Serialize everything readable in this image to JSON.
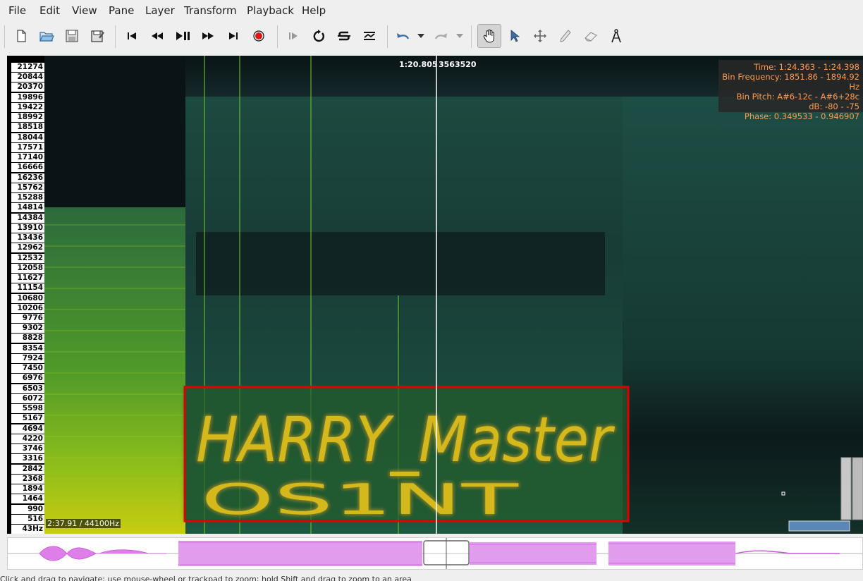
{
  "menubar": {
    "items": [
      {
        "label": "File"
      },
      {
        "label": "Edit"
      },
      {
        "label": "View"
      },
      {
        "label": "Pane"
      },
      {
        "label": "Layer"
      },
      {
        "label": "Transform"
      },
      {
        "label": "Playback"
      },
      {
        "label": "Help"
      }
    ]
  },
  "toolbar": {
    "icons": [
      "new-file-icon",
      "open-folder-icon",
      "save-icon",
      "save-as-icon",
      "rewind-start-icon",
      "rewind-icon",
      "play-pause-icon",
      "fast-forward-icon",
      "fast-forward-end-icon",
      "record-icon",
      "play-selection-icon",
      "loop-icon",
      "solo-icon",
      "normalize-icon",
      "undo-icon",
      "undo-dropdown-icon",
      "redo-icon",
      "redo-dropdown-icon",
      "navigate-hand-icon",
      "select-pointer-icon",
      "move-icon",
      "draw-pencil-icon",
      "erase-icon",
      "measure-icon"
    ]
  },
  "spectrogram": {
    "freq_ticks": [
      "21274",
      "20844",
      "20370",
      "19896",
      "19422",
      "18992",
      "18518",
      "18044",
      "17571",
      "17140",
      "16666",
      "16236",
      "15762",
      "15288",
      "14814",
      "14384",
      "13910",
      "13436",
      "12962",
      "12532",
      "12058",
      "11627",
      "11154",
      "10680",
      "10206",
      "9776",
      "9302",
      "8828",
      "8354",
      "7924",
      "7450",
      "6976",
      "6503",
      "6072",
      "5598",
      "5167",
      "4694",
      "4220",
      "3746",
      "3316",
      "2842",
      "2368",
      "1894",
      "1464",
      "990",
      "516",
      "43Hz"
    ],
    "cursor_time": "1:20.805",
    "cursor_frame": "3563520",
    "duration": "2:37.91 / 44100Hz",
    "status": {
      "time": "Time: 1:24.363 - 1:24.398",
      "bin_frequency": "Bin Frequency: 1851.86 - 1894.92 Hz",
      "bin_pitch": "Bin Pitch: A#6-12c - A#6+28c",
      "db": "dB: -80 - -75",
      "phase": "Phase: 0.349533 - 0.946907"
    },
    "hidden_text_line1": "HARRY_Master",
    "hidden_text_line2": "OS1NT",
    "highlight_color": "#e00000"
  },
  "statusbar": {
    "text": "Click and drag to navigate; use mouse-wheel or trackpad to zoom; hold Shift and drag to zoom to an area"
  }
}
